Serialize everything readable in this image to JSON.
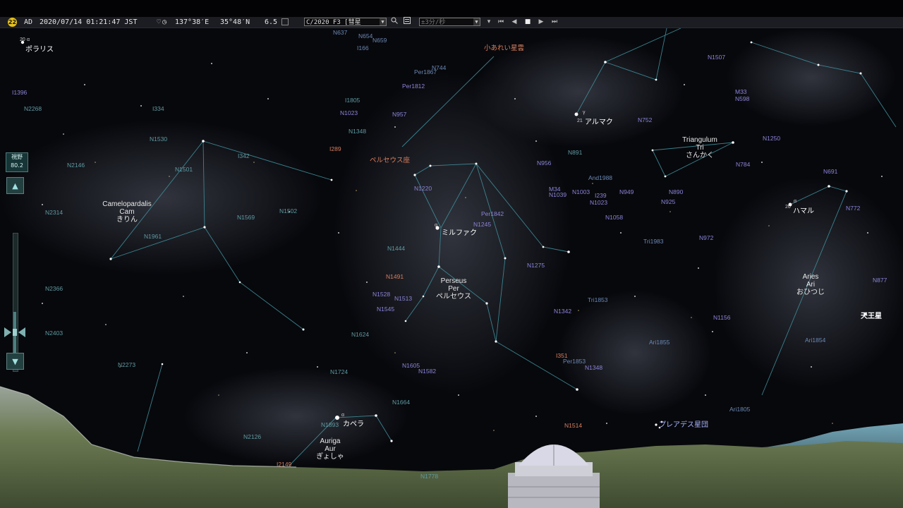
{
  "toolbar": {
    "day_badge": "22",
    "era": "AD",
    "datetime": "2020/07/14 01:21:47 JST",
    "longitude": "137°38′E",
    "latitude": "35°48′N",
    "magnitude_limit": "6.5",
    "target_combo": "C/2020 F3 [彗星 C/2020",
    "speed_combo": "±3分/秒",
    "icons": [
      "search-icon",
      "list-icon",
      "prev-end-icon",
      "prev-icon",
      "stop-icon",
      "play-icon",
      "next-end-icon"
    ]
  },
  "left_control": {
    "fov_label": "視野",
    "fov_value": "80.2",
    "up_symbol": "▲",
    "down_symbol": "▼",
    "zoom_fraction": 0.42
  },
  "constellations": [
    {
      "latin": "Camelopardalis",
      "abbr": "Cam",
      "japanese": "きりん"
    },
    {
      "latin": "Perseus",
      "abbr": "Per",
      "japanese": "ペルセウス"
    },
    {
      "latin": "Triangulum",
      "abbr": "Tri",
      "japanese": "さんかく"
    },
    {
      "latin": "Aries",
      "abbr": "Ari",
      "japanese": "おひつじ"
    },
    {
      "latin": "Auriga",
      "abbr": "Aur",
      "japanese": "ぎょしゃ"
    }
  ],
  "stars": {
    "polaris": "ポラリス",
    "mirfak": "ミルファク",
    "capella": "カペラ",
    "almach": "アルマク",
    "hamal": "ハマル",
    "uranus": "天王星",
    "pleiades": "プレアデス星団",
    "perseus_star": "ペルセウス座",
    "small_cloud": "小あれい星雲"
  },
  "star_prefixes": {
    "polaris_num": "20",
    "alpha": "α",
    "gamma": "γ",
    "almach_num": "21",
    "hamal_num": "20",
    "mirfak_num": "18"
  },
  "deep_sky": [
    "N637",
    "I166",
    "N654",
    "N659",
    "N744",
    "Per1867",
    "Per1812",
    "N1023",
    "I1805",
    "N957",
    "N1348",
    "I289",
    "N2268",
    "I334",
    "N1530",
    "N2146",
    "I342",
    "N1501",
    "N1502",
    "N1569",
    "N2314",
    "N1961",
    "N1444",
    "N1491",
    "N1513",
    "N1528",
    "N1545",
    "N1624",
    "N1605",
    "N1724",
    "N1582",
    "N1664",
    "N2366",
    "N2403",
    "N2273",
    "N1893",
    "N2126",
    "N1778",
    "N1514",
    "I2149",
    "N891",
    "N956",
    "M34",
    "N1039",
    "N1003",
    "And1988",
    "I239",
    "N1023",
    "N949",
    "N925",
    "N890",
    "N1058",
    "N752",
    "N784",
    "N772",
    "N691",
    "N972",
    "Tri1983",
    "N1275",
    "Per1842",
    "N1245",
    "N1220",
    "N1342",
    "Tri1853",
    "N1156",
    "Ari1855",
    "Ari1854",
    "N877",
    "Ari1805",
    "I351",
    "Per1853",
    "N1348",
    "M33",
    "N598",
    "N1507",
    "N1250",
    "I1396"
  ]
}
